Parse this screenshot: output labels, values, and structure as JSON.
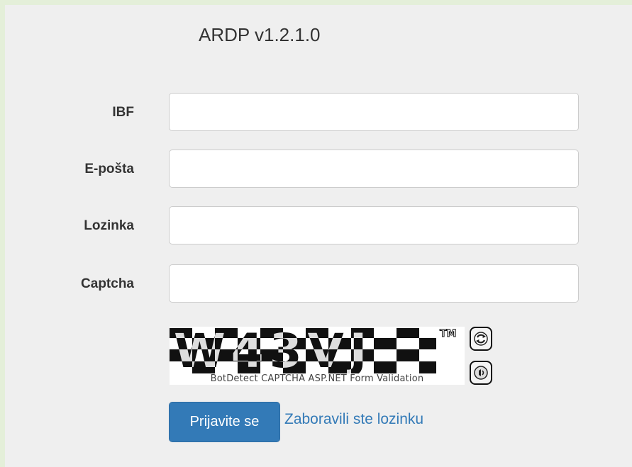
{
  "app": {
    "title": "ARDP v1.2.1.0"
  },
  "form": {
    "fields": [
      {
        "label": "IBF",
        "value": ""
      },
      {
        "label": "E-pošta",
        "value": ""
      },
      {
        "label": "Lozinka",
        "value": ""
      },
      {
        "label": "Captcha",
        "value": ""
      }
    ]
  },
  "captcha": {
    "code": "W43VJ",
    "trademark": "TM",
    "caption": "BotDetect CAPTCHA ASP.NET Form Validation",
    "reload_icon": "reload-icon",
    "sound_icon": "speaker-icon"
  },
  "actions": {
    "login_label": "Prijavite se",
    "forgot_label": "Zaboravili ste lozinku"
  },
  "colors": {
    "page_background": "#e4efd9",
    "panel_background": "#efefef",
    "primary": "#337ab7",
    "link": "#337ab7"
  }
}
